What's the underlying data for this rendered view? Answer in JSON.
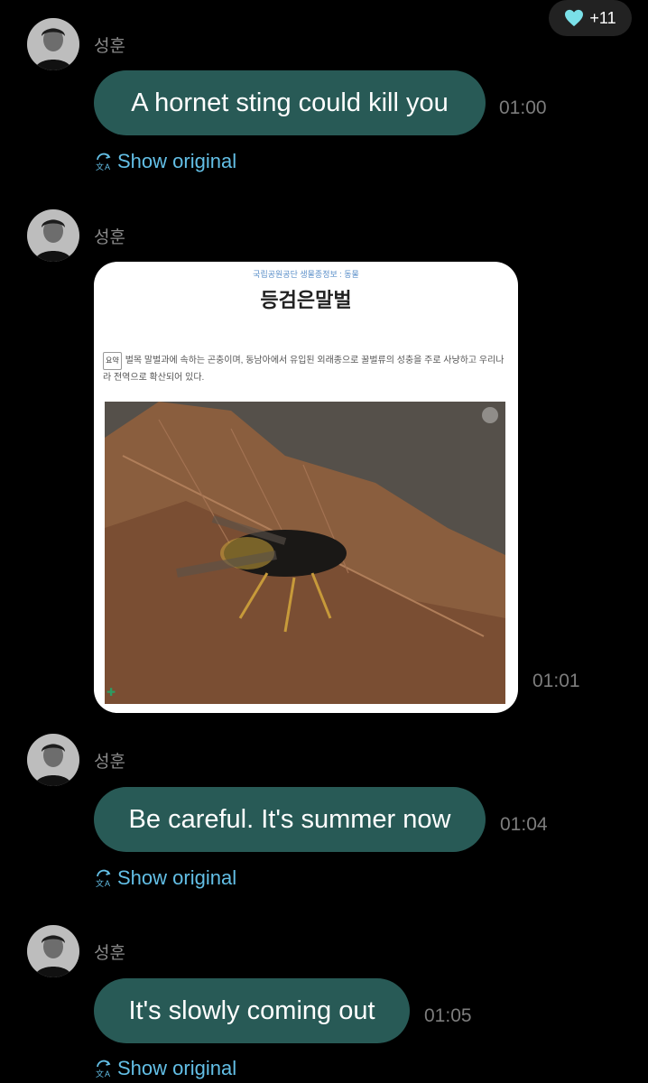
{
  "reaction": {
    "icon": "heart-icon",
    "count": "+11",
    "color": "#7ae0e8"
  },
  "sender_name": "성훈",
  "messages": [
    {
      "text": "A hornet sting could kill you",
      "time": "01:00",
      "show_original": "Show original"
    },
    {
      "time": "01:01",
      "card": {
        "breadcrumb": "국립공원공단 생물종정보 : 동물",
        "title": "등검은말벌",
        "summary_tag": "요약",
        "description": "벌목 말벌과에 속하는 곤충이며, 동남아에서 유입된 외래종으로 꿀벌류의 성충을 주로 사냥하고 우리나라 전역으로 확산되어 있다.",
        "photo": "hornet-on-leaf-photo"
      }
    },
    {
      "text": "Be careful. It's summer now",
      "time": "01:04",
      "show_original": "Show original"
    },
    {
      "text": "It's slowly coming out",
      "time": "01:05",
      "show_original": "Show original"
    }
  ],
  "colors": {
    "bubble": "#285a56",
    "link": "#63bfe6",
    "background": "#000000"
  }
}
